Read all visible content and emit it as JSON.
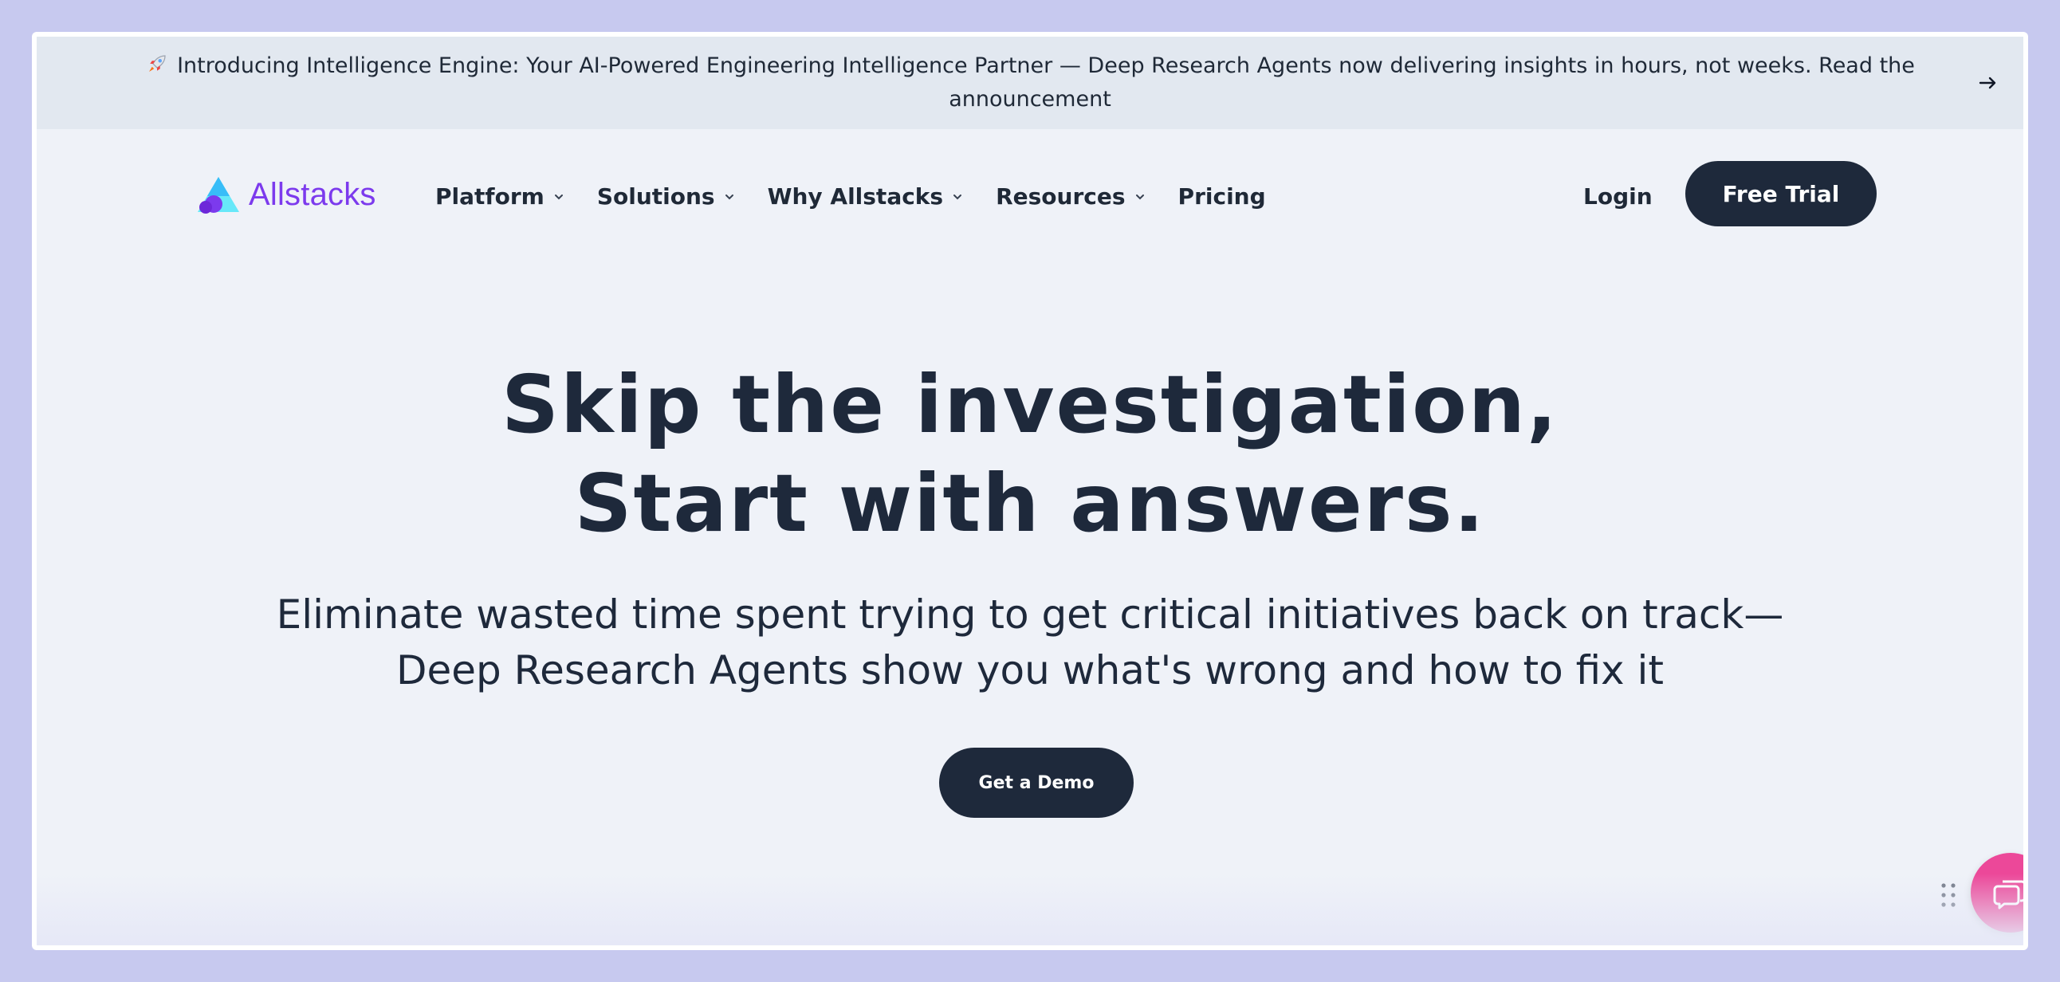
{
  "announcement": {
    "text": "Introducing Intelligence Engine: Your AI-Powered Engineering Intelligence Partner — Deep Research Agents now delivering insights in hours, not weeks. Read the announcement",
    "icon": "rocket-icon",
    "arrow_icon": "arrow-right-icon"
  },
  "header": {
    "logo_text": "Allstacks",
    "nav": [
      {
        "label": "Platform",
        "has_dropdown": true
      },
      {
        "label": "Solutions",
        "has_dropdown": true
      },
      {
        "label": "Why Allstacks",
        "has_dropdown": true
      },
      {
        "label": "Resources",
        "has_dropdown": true
      },
      {
        "label": "Pricing",
        "has_dropdown": false
      }
    ],
    "login_label": "Login",
    "free_trial_label": "Free Trial"
  },
  "hero": {
    "title_line1": "Skip the investigation,",
    "title_line2": "Start with answers.",
    "subtitle_line1": "Eliminate wasted time spent trying to get critical initiatives back on track—",
    "subtitle_line2": "Deep Research Agents show you what's wrong and how to fix it",
    "cta_label": "Get a Demo"
  },
  "chat_widget": {
    "icon": "chat-icon",
    "handle_icon": "drag-handle-icon"
  },
  "colors": {
    "primary_dark": "#1e293b",
    "brand_purple": "#7c3aed",
    "chat_pink": "#ec4899",
    "page_bg": "#eff2f8",
    "announce_bg": "#e2e8f0"
  }
}
